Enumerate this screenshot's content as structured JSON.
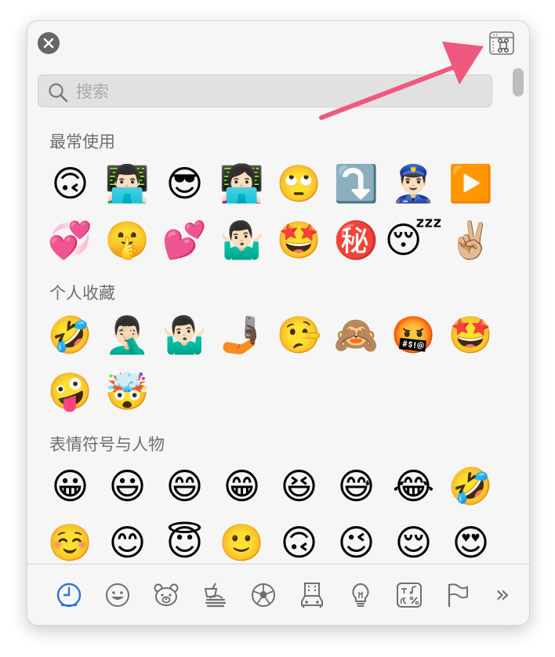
{
  "search": {
    "placeholder": "搜索",
    "value": ""
  },
  "sections": [
    {
      "title": "最常使用",
      "emojis": [
        "🙃",
        "👨🏻‍💻",
        "😎",
        "👩🏻‍💻",
        "🙄",
        "⤵️",
        "👮🏻‍♂️",
        "▶️",
        "💞",
        "🤫",
        "💕",
        "🤷🏻‍♂️",
        "🤩",
        "㊙️",
        "😴",
        "✌🏼"
      ]
    },
    {
      "title": "个人收藏",
      "emojis": [
        "🤣",
        "🤦🏻‍♂️",
        "🤷🏻‍♂️",
        "🤳🏿",
        "🤥",
        "🙈",
        "🤬",
        "🤩",
        "🤪",
        "🤯"
      ]
    },
    {
      "title": "表情符号与人物",
      "emojis": [
        "😀",
        "😃",
        "😄",
        "😁",
        "😆",
        "😅",
        "😂",
        "🤣",
        "☺️",
        "😊",
        "😇",
        "🙂",
        "🙃",
        "😉",
        "😌",
        "😍"
      ]
    }
  ],
  "tabbar": {
    "tabs": [
      {
        "icon": "recent-clock-icon",
        "active": true
      },
      {
        "icon": "smiley-icon",
        "active": false
      },
      {
        "icon": "bear-icon",
        "active": false
      },
      {
        "icon": "food-icon",
        "active": false
      },
      {
        "icon": "soccer-ball-icon",
        "active": false
      },
      {
        "icon": "building-car-icon",
        "active": false
      },
      {
        "icon": "lightbulb-icon",
        "active": false
      },
      {
        "icon": "symbols-icon",
        "active": false
      },
      {
        "icon": "flag-icon",
        "active": false
      }
    ],
    "more_label": "»"
  },
  "colors": {
    "accent": "#2b74d9",
    "icon_gray": "#6f6f6f",
    "arrow": "#f0587f"
  }
}
